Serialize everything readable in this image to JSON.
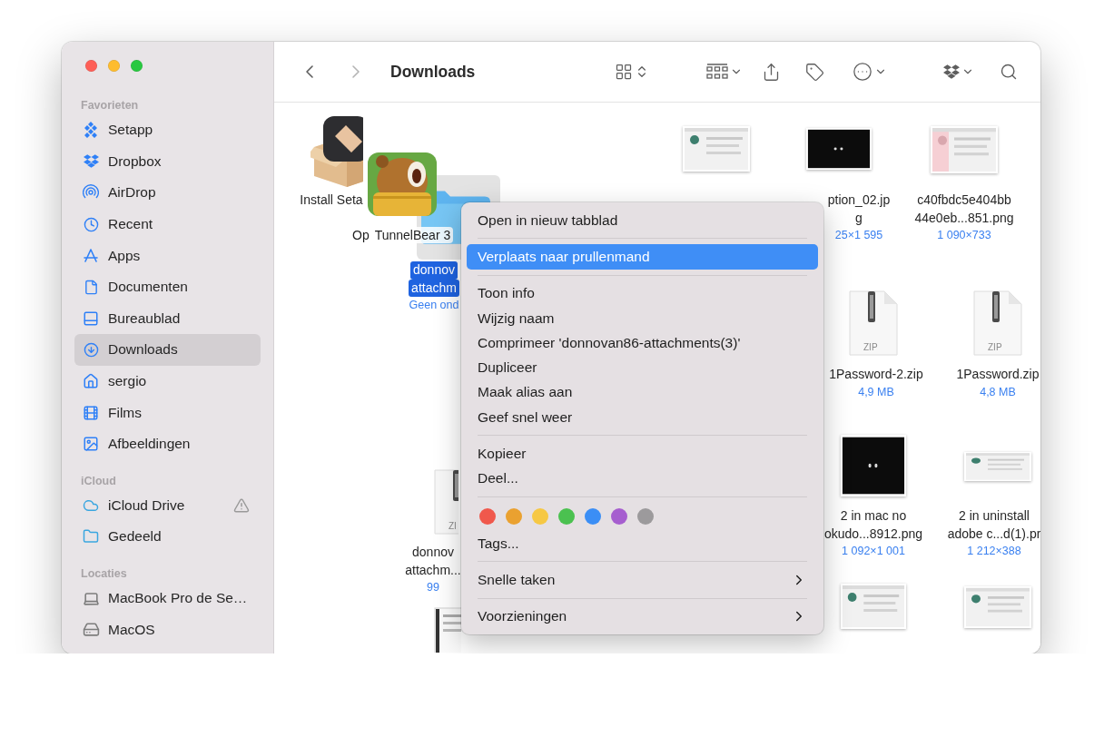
{
  "window": {
    "title": "Downloads"
  },
  "navigation": {
    "back_disabled": false,
    "forward_disabled": true
  },
  "sidebar": {
    "sections": [
      {
        "title": "Favorieten",
        "items": [
          {
            "label": "Setapp",
            "selected": false
          },
          {
            "label": "Dropbox",
            "selected": false
          },
          {
            "label": "AirDrop",
            "selected": false
          },
          {
            "label": "Recent",
            "selected": false
          },
          {
            "label": "Apps",
            "selected": false
          },
          {
            "label": "Documenten",
            "selected": false
          },
          {
            "label": "Bureaublad",
            "selected": false
          },
          {
            "label": "Downloads",
            "selected": true
          },
          {
            "label": "sergio",
            "selected": false
          },
          {
            "label": "Films",
            "selected": false
          },
          {
            "label": "Afbeeldingen",
            "selected": false
          }
        ]
      },
      {
        "title": "iCloud",
        "items": [
          {
            "label": "iCloud Drive",
            "selected": false,
            "warning": true
          },
          {
            "label": "Gedeeld",
            "selected": false,
            "warning": false
          }
        ]
      },
      {
        "title": "Locaties",
        "items": [
          {
            "label": "MacBook Pro de Se…",
            "selected": false
          },
          {
            "label": "MacOS",
            "selected": false
          }
        ]
      }
    ]
  },
  "files": [
    {
      "kind": "installer",
      "lines": [
        "Install Seta"
      ],
      "selected": false
    },
    {
      "kind": "folder",
      "lines": [
        "donnov",
        "attachm"
      ],
      "meta": "Geen ond",
      "selected": true
    },
    {
      "kind": "screenshot-light",
      "selected": false
    },
    {
      "kind": "screenshot-dark",
      "lines": [
        "ption_02.jp",
        "g"
      ],
      "meta": "25×1 595",
      "selected": false
    },
    {
      "kind": "screenshot-pink",
      "lines": [
        "c40fbdc5e404bb",
        "44e0eb...851.png"
      ],
      "meta": "1 090×733",
      "selected": false
    },
    {
      "kind": "zip",
      "badge": "ZIP",
      "lines": [
        "1Password-2.zip"
      ],
      "meta": "4,9 MB",
      "selected": false
    },
    {
      "kind": "zip",
      "badge": "ZIP",
      "lines": [
        "1Password.zip"
      ],
      "meta": "4,8 MB",
      "selected": false
    },
    {
      "kind": "screenshot-dark",
      "lines": [
        "2 in mac no",
        "okudo...8912.png"
      ],
      "meta": "1 092×1 001",
      "selected": false
    },
    {
      "kind": "screenshot-light",
      "lines": [
        "2 in uninstall",
        "adobe c...d(1).pr"
      ],
      "meta": "1 212×388",
      "selected": false
    },
    {
      "kind": "zip",
      "badge": "ZI",
      "lines": [
        "donnov",
        "attachm..."
      ],
      "meta": "99",
      "selected": false
    },
    {
      "kind": "document",
      "selected": false
    },
    {
      "kind": "screenshot-light",
      "selected": false
    },
    {
      "kind": "screenshot-light",
      "selected": false
    }
  ],
  "drag": {
    "labels": [
      "Op",
      "TunnelBear 3"
    ]
  },
  "context_menu": {
    "items": [
      {
        "kind": "item",
        "label": "Open in nieuw tabblad",
        "selected": false
      },
      {
        "kind": "separator"
      },
      {
        "kind": "item",
        "label": "Verplaats naar prullenmand",
        "selected": true
      },
      {
        "kind": "separator"
      },
      {
        "kind": "item",
        "label": "Toon info",
        "selected": false
      },
      {
        "kind": "item",
        "label": "Wijzig naam",
        "selected": false
      },
      {
        "kind": "item",
        "label": "Comprimeer 'donnovan86-attachments(3)'",
        "selected": false
      },
      {
        "kind": "item",
        "label": "Dupliceer",
        "selected": false
      },
      {
        "kind": "item",
        "label": "Maak alias aan",
        "selected": false
      },
      {
        "kind": "item",
        "label": "Geef snel weer",
        "selected": false
      },
      {
        "kind": "separator"
      },
      {
        "kind": "item",
        "label": "Kopieer",
        "selected": false
      },
      {
        "kind": "item",
        "label": "Deel...",
        "selected": false
      },
      {
        "kind": "separator"
      },
      {
        "kind": "colors",
        "colors": [
          {
            "color": "#f0584c"
          },
          {
            "color": "#eaa130"
          },
          {
            "color": "#f6c844"
          },
          {
            "color": "#4bc150"
          },
          {
            "color": "#3b8ef5"
          },
          {
            "color": "#a65ecf"
          },
          {
            "color": "#9c9a9c"
          }
        ]
      },
      {
        "kind": "item",
        "label": "Tags...",
        "selected": false
      },
      {
        "kind": "separator"
      },
      {
        "kind": "submenu",
        "label": "Snelle taken",
        "selected": false
      },
      {
        "kind": "separator"
      },
      {
        "kind": "submenu",
        "label": "Voorzieningen",
        "selected": false
      }
    ]
  }
}
